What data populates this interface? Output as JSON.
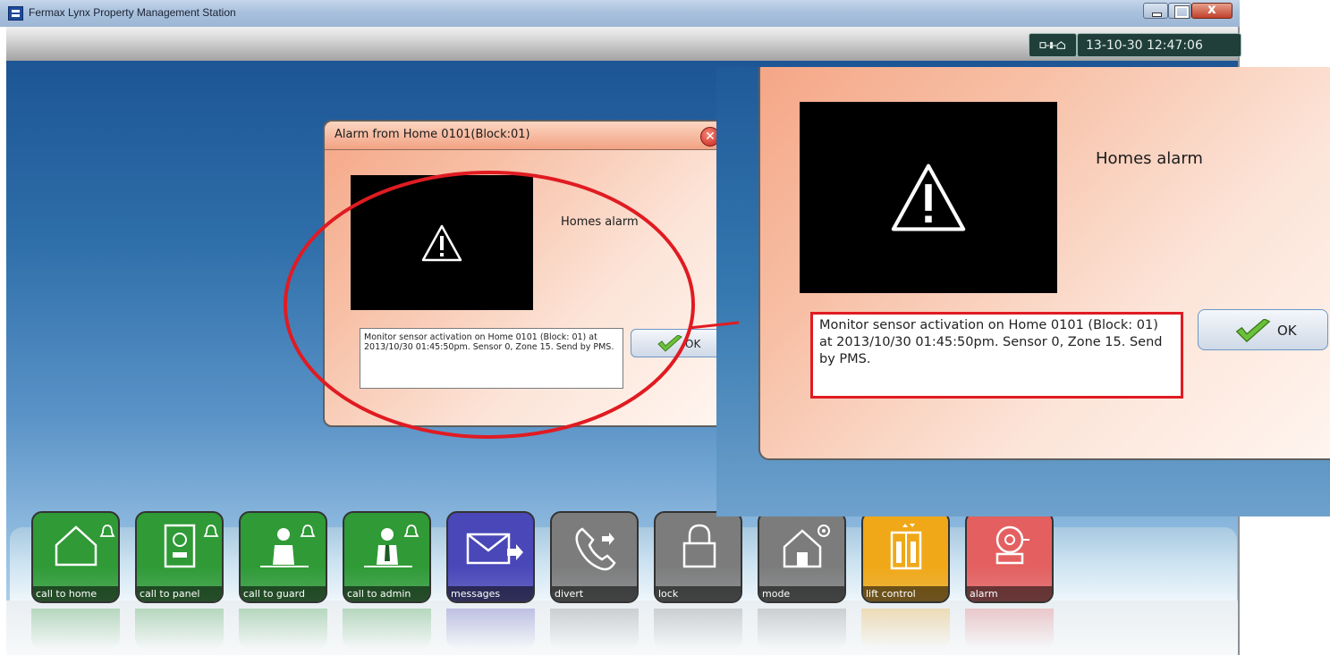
{
  "window": {
    "title": "Fermax Lynx Property Management Station"
  },
  "toolbar": {
    "network_icon": "network-status-icon",
    "clock": "13-10-30 12:47:06"
  },
  "dialog": {
    "title": "Alarm from Home 0101(Block:01)",
    "close_icon": "close-icon",
    "alarm_type": "Homes alarm",
    "message": "Monitor sensor activation on Home 0101 (Block: 01) at 2013/10/30 01:45:50pm. Sensor 0, Zone 15. Send by PMS.",
    "ok_label": "OK",
    "icon": "warning-icon"
  },
  "callout": {
    "alarm_type": "Homes alarm",
    "message": "Monitor sensor activation on Home 0101 (Block: 01) at 2013/10/30 01:45:50pm. Sensor 0, Zone 15. Send by PMS.",
    "ok_label": "OK",
    "highlight_color": "#e01b22"
  },
  "dock": {
    "buttons": [
      {
        "label": "call to home",
        "icon": "house-bell-icon",
        "color": "#2f9a36"
      },
      {
        "label": "call to panel",
        "icon": "entry-panel-bell-icon",
        "color": "#2f9a36"
      },
      {
        "label": "call to guard",
        "icon": "guard-bell-icon",
        "color": "#2f9a36"
      },
      {
        "label": "call to admin",
        "icon": "admin-bell-icon",
        "color": "#2f9a36"
      },
      {
        "label": "messages",
        "icon": "envelope-icon",
        "color": "#4a47b8"
      },
      {
        "label": "divert",
        "icon": "phone-divert-icon",
        "color": "#7c7c7c"
      },
      {
        "label": "lock",
        "icon": "padlock-icon",
        "color": "#7c7c7c"
      },
      {
        "label": "mode",
        "icon": "house-gear-icon",
        "color": "#7c7c7c"
      },
      {
        "label": "lift control",
        "icon": "elevator-icon",
        "color": "#f0a818"
      },
      {
        "label": "alarm",
        "icon": "alarm-bell-icon",
        "color": "#e46060"
      }
    ]
  }
}
